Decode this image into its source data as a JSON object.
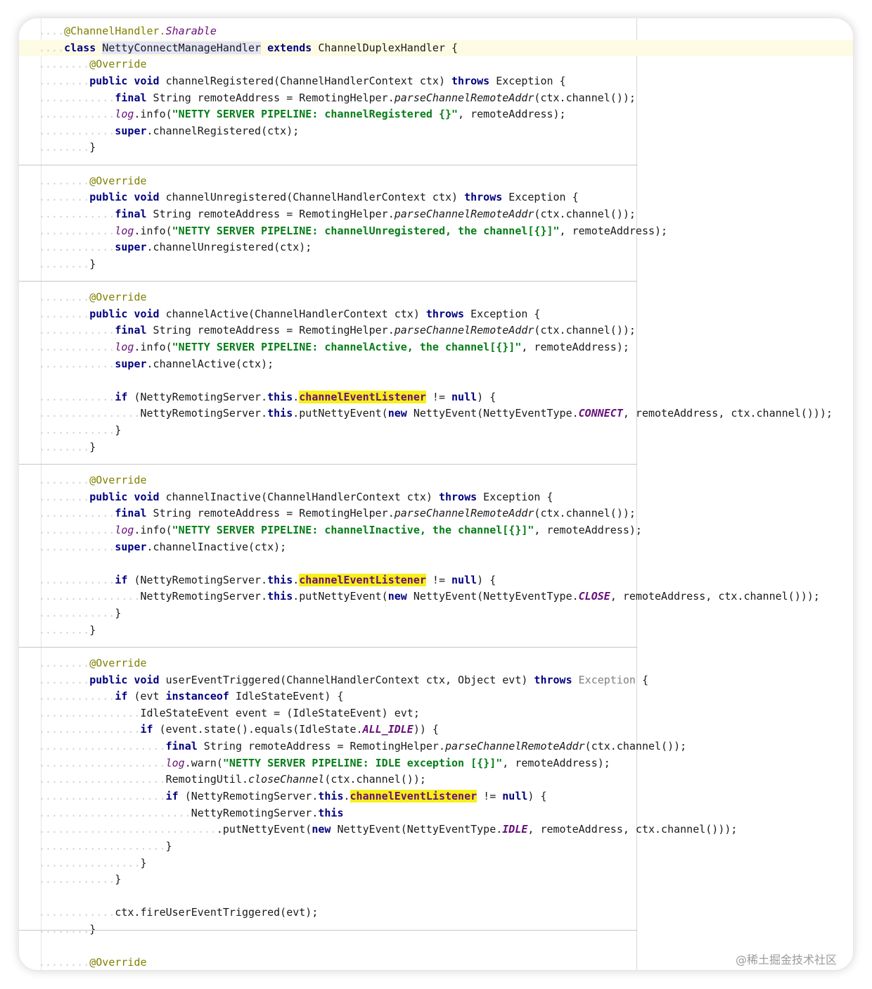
{
  "editor": {
    "lines": [
      [
        [
          "ann",
          "@ChannelHandler."
        ],
        [
          "sf",
          "Sharable"
        ]
      ],
      [
        [
          "kw",
          "class"
        ],
        [
          "t",
          " "
        ],
        [
          "hlc",
          "NettyConnectManageHandler"
        ],
        [
          "t",
          " "
        ],
        [
          "kw",
          "extends"
        ],
        [
          "t",
          " ChannelDuplexHandler {"
        ]
      ],
      [
        [
          "ann",
          "@Override"
        ]
      ],
      [
        [
          "kw",
          "public void"
        ],
        [
          "t",
          " channelRegistered(ChannelHandlerContext ctx) "
        ],
        [
          "kw",
          "throws"
        ],
        [
          "t",
          " Exception {"
        ]
      ],
      [
        [
          "kw",
          "final"
        ],
        [
          "t",
          " String remoteAddress = RemotingHelper."
        ],
        [
          "it",
          "parseChannelRemoteAddr"
        ],
        [
          "t",
          "(ctx.channel());"
        ]
      ],
      [
        [
          "sf",
          "log"
        ],
        [
          "t",
          ".info("
        ],
        [
          "str",
          "\"NETTY SERVER PIPELINE: channelRegistered {}\""
        ],
        [
          "t",
          ", remoteAddress);"
        ]
      ],
      [
        [
          "kw",
          "super"
        ],
        [
          "t",
          ".channelRegistered(ctx);"
        ]
      ],
      [
        [
          "t",
          "}"
        ]
      ],
      [],
      [
        [
          "ann",
          "@Override"
        ]
      ],
      [
        [
          "kw",
          "public void"
        ],
        [
          "t",
          " channelUnregistered(ChannelHandlerContext ctx) "
        ],
        [
          "kw",
          "throws"
        ],
        [
          "t",
          " Exception {"
        ]
      ],
      [
        [
          "kw",
          "final"
        ],
        [
          "t",
          " String remoteAddress = RemotingHelper."
        ],
        [
          "it",
          "parseChannelRemoteAddr"
        ],
        [
          "t",
          "(ctx.channel());"
        ]
      ],
      [
        [
          "sf",
          "log"
        ],
        [
          "t",
          ".info("
        ],
        [
          "str",
          "\"NETTY SERVER PIPELINE: channelUnregistered, the channel[{}]\""
        ],
        [
          "t",
          ", remoteAddress);"
        ]
      ],
      [
        [
          "kw",
          "super"
        ],
        [
          "t",
          ".channelUnregistered(ctx);"
        ]
      ],
      [
        [
          "t",
          "}"
        ]
      ],
      [],
      [
        [
          "ann",
          "@Override"
        ]
      ],
      [
        [
          "kw",
          "public void"
        ],
        [
          "t",
          " channelActive(ChannelHandlerContext ctx) "
        ],
        [
          "kw",
          "throws"
        ],
        [
          "t",
          " Exception {"
        ]
      ],
      [
        [
          "kw",
          "final"
        ],
        [
          "t",
          " String remoteAddress = RemotingHelper."
        ],
        [
          "it",
          "parseChannelRemoteAddr"
        ],
        [
          "t",
          "(ctx.channel());"
        ]
      ],
      [
        [
          "sf",
          "log"
        ],
        [
          "t",
          ".info("
        ],
        [
          "str",
          "\"NETTY SERVER PIPELINE: channelActive, the channel[{}]\""
        ],
        [
          "t",
          ", remoteAddress);"
        ]
      ],
      [
        [
          "kw",
          "super"
        ],
        [
          "t",
          ".channelActive(ctx);"
        ]
      ],
      [],
      [
        [
          "kw",
          "if"
        ],
        [
          "t",
          " (NettyRemotingServer."
        ],
        [
          "kw",
          "this"
        ],
        [
          "t",
          "."
        ],
        [
          "hlf",
          "channelEventListener"
        ],
        [
          "t",
          " != "
        ],
        [
          "kw",
          "null"
        ],
        [
          "t",
          ") {"
        ]
      ],
      [
        [
          "t",
          "NettyRemotingServer."
        ],
        [
          "kw",
          "this"
        ],
        [
          "t",
          ".putNettyEvent("
        ],
        [
          "kw",
          "new"
        ],
        [
          "t",
          " NettyEvent(NettyEventType."
        ],
        [
          "cst",
          "CONNECT"
        ],
        [
          "t",
          ", remoteAddress, ctx.channel()));"
        ]
      ],
      [
        [
          "t",
          "}"
        ]
      ],
      [
        [
          "t",
          "}"
        ]
      ],
      [],
      [
        [
          "ann",
          "@Override"
        ]
      ],
      [
        [
          "kw",
          "public void"
        ],
        [
          "t",
          " channelInactive(ChannelHandlerContext ctx) "
        ],
        [
          "kw",
          "throws"
        ],
        [
          "t",
          " Exception {"
        ]
      ],
      [
        [
          "kw",
          "final"
        ],
        [
          "t",
          " String remoteAddress = RemotingHelper."
        ],
        [
          "it",
          "parseChannelRemoteAddr"
        ],
        [
          "t",
          "(ctx.channel());"
        ]
      ],
      [
        [
          "sf",
          "log"
        ],
        [
          "t",
          ".info("
        ],
        [
          "str",
          "\"NETTY SERVER PIPELINE: channelInactive, the channel[{}]\""
        ],
        [
          "t",
          ", remoteAddress);"
        ]
      ],
      [
        [
          "kw",
          "super"
        ],
        [
          "t",
          ".channelInactive(ctx);"
        ]
      ],
      [],
      [
        [
          "kw",
          "if"
        ],
        [
          "t",
          " (NettyRemotingServer."
        ],
        [
          "kw",
          "this"
        ],
        [
          "t",
          "."
        ],
        [
          "hlf",
          "channelEventListener"
        ],
        [
          "t",
          " != "
        ],
        [
          "kw",
          "null"
        ],
        [
          "t",
          ") {"
        ]
      ],
      [
        [
          "t",
          "NettyRemotingServer."
        ],
        [
          "kw",
          "this"
        ],
        [
          "t",
          ".putNettyEvent("
        ],
        [
          "kw",
          "new"
        ],
        [
          "t",
          " NettyEvent(NettyEventType."
        ],
        [
          "cst",
          "CLOSE"
        ],
        [
          "t",
          ", remoteAddress, ctx.channel()));"
        ]
      ],
      [
        [
          "t",
          "}"
        ]
      ],
      [
        [
          "t",
          "}"
        ]
      ],
      [],
      [
        [
          "ann",
          "@Override"
        ]
      ],
      [
        [
          "kw",
          "public void"
        ],
        [
          "t",
          " userEventTriggered(ChannelHandlerContext ctx, Object evt) "
        ],
        [
          "kw",
          "throws"
        ],
        [
          "t",
          " "
        ],
        [
          "mute",
          "Exception"
        ],
        [
          "t",
          " {"
        ]
      ],
      [
        [
          "kw",
          "if"
        ],
        [
          "t",
          " (evt "
        ],
        [
          "kw",
          "instanceof"
        ],
        [
          "t",
          " IdleStateEvent) {"
        ]
      ],
      [
        [
          "t",
          "IdleStateEvent event = (IdleStateEvent) evt;"
        ]
      ],
      [
        [
          "kw",
          "if"
        ],
        [
          "t",
          " (event.state().equals(IdleState."
        ],
        [
          "cst",
          "ALL_IDLE"
        ],
        [
          "t",
          ")) {"
        ]
      ],
      [
        [
          "kw",
          "final"
        ],
        [
          "t",
          " String remoteAddress = RemotingHelper."
        ],
        [
          "it",
          "parseChannelRemoteAddr"
        ],
        [
          "t",
          "(ctx.channel());"
        ]
      ],
      [
        [
          "sf",
          "log"
        ],
        [
          "t",
          ".warn("
        ],
        [
          "str",
          "\"NETTY SERVER PIPELINE: IDLE exception [{}]\""
        ],
        [
          "t",
          ", remoteAddress);"
        ]
      ],
      [
        [
          "t",
          "RemotingUtil."
        ],
        [
          "it",
          "closeChannel"
        ],
        [
          "t",
          "(ctx.channel());"
        ]
      ],
      [
        [
          "kw",
          "if"
        ],
        [
          "t",
          " (NettyRemotingServer."
        ],
        [
          "kw",
          "this"
        ],
        [
          "t",
          "."
        ],
        [
          "hlf",
          "channelEventListener"
        ],
        [
          "t",
          " != "
        ],
        [
          "kw",
          "null"
        ],
        [
          "t",
          ") {"
        ]
      ],
      [
        [
          "t",
          "NettyRemotingServer."
        ],
        [
          "kw",
          "this"
        ]
      ],
      [
        [
          "t",
          ".putNettyEvent("
        ],
        [
          "kw",
          "new"
        ],
        [
          "t",
          " NettyEvent(NettyEventType."
        ],
        [
          "cst",
          "IDLE"
        ],
        [
          "t",
          ", remoteAddress, ctx.channel()));"
        ]
      ],
      [
        [
          "t",
          "}"
        ]
      ],
      [
        [
          "t",
          "}"
        ]
      ],
      [
        [
          "t",
          "}"
        ]
      ],
      [],
      [
        [
          "t",
          "ctx.fireUserEventTriggered(evt);"
        ]
      ],
      [
        [
          "t",
          "}"
        ]
      ],
      [],
      [
        [
          "ann",
          "@Override"
        ]
      ]
    ]
  },
  "watermark": "@稀土掘金技术社区"
}
